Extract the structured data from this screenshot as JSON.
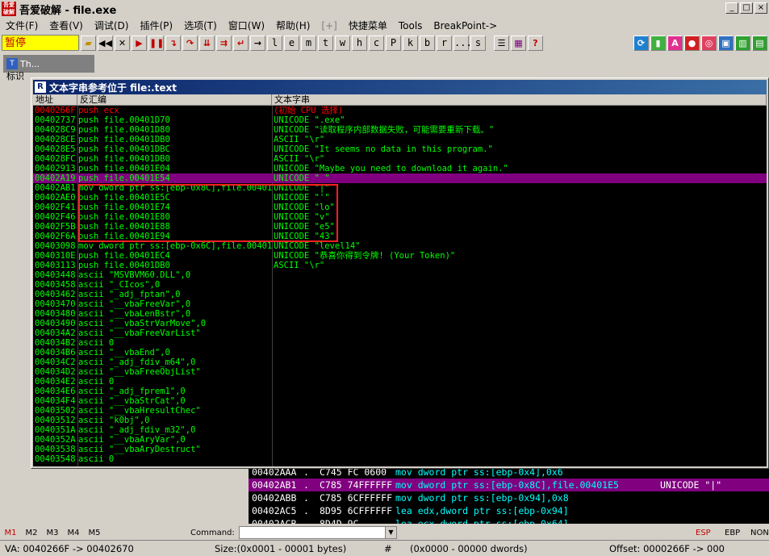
{
  "window": {
    "logo_text": "吾爱破解",
    "title": "吾爱破解 - file.exe",
    "min": "_",
    "max": "□",
    "close": "×"
  },
  "menu": [
    "文件(F)",
    "查看(V)",
    "调试(D)",
    "插件(P)",
    "选项(T)",
    "窗口(W)",
    "帮助(H)",
    "[+]",
    "快捷菜单",
    "Tools",
    "BreakPoint->"
  ],
  "toolbar": {
    "status": "暂停",
    "letters": [
      "l",
      "e",
      "m",
      "t",
      "w",
      "h",
      "c",
      "P",
      "k",
      "b",
      "r",
      "...",
      "s"
    ]
  },
  "mini_window": {
    "icon": "T",
    "title": "Th...",
    "label": "标识"
  },
  "dialog": {
    "icon": "R",
    "title": "文本字串参考位于 file:.text",
    "columns": [
      "地址",
      "反汇编",
      "文本字串"
    ],
    "rows": [
      {
        "addr": "0040266F",
        "dis": "push ecx",
        "str": "(初始 CPU 选择)",
        "style": "r"
      },
      {
        "addr": "00402737",
        "dis": "push file.00401D70",
        "str": "UNICODE \".exe\"",
        "style": "g"
      },
      {
        "addr": "004028C9",
        "dis": "push file.00401D80",
        "str": "UNICODE \"读取程序内部数据失败，可能需要重新下载。\"",
        "style": "g"
      },
      {
        "addr": "004028CE",
        "dis": "push file.00401DB0",
        "str": "ASCII \"\\r\"",
        "style": "g"
      },
      {
        "addr": "004028E5",
        "dis": "push file.00401DBC",
        "str": "UNICODE \"It seems no data in this program.\"",
        "style": "g"
      },
      {
        "addr": "004028FC",
        "dis": "push file.00401DB0",
        "str": "ASCII \"\\r\"",
        "style": "g"
      },
      {
        "addr": "00402913",
        "dis": "push file.00401E04",
        "str": "UNICODE \"Maybe you need to download it again.\"",
        "style": "g"
      },
      {
        "addr": "00402A19",
        "dis": "push file.00401E54",
        "str": "UNICODE \" \"",
        "style": "sel"
      },
      {
        "addr": "00402AB1",
        "dis": "mov dword ptr ss:[ebp-0x8C],file.00401E5",
        "str": "UNICODE \"|\"",
        "style": "g"
      },
      {
        "addr": "00402AE0",
        "dis": "push file.00401E5C",
        "str": "UNICODE \"'\"",
        "style": "g"
      },
      {
        "addr": "00402F41",
        "dis": "push file.00401E74",
        "str": "UNICODE \"lo\"",
        "style": "g"
      },
      {
        "addr": "00402F46",
        "dis": "push file.00401E80",
        "str": "UNICODE \"v\"",
        "style": "g"
      },
      {
        "addr": "00402F5B",
        "dis": "push file.00401E88",
        "str": "UNICODE \"e5\"",
        "style": "g"
      },
      {
        "addr": "00402F6A",
        "dis": "push file.00401E94",
        "str": "UNICODE \"43\"",
        "style": "g"
      },
      {
        "addr": "00403098",
        "dis": "mov dword ptr ss:[ebp-0x6C],file.00401EA",
        "str": "UNICODE \"level14\"",
        "style": "g"
      },
      {
        "addr": "0040310E",
        "dis": "push file.00401EC4",
        "str": "UNICODE \"恭喜你得到令牌! (Your Token)\"",
        "style": "g"
      },
      {
        "addr": "00403113",
        "dis": "push file.00401DB0",
        "str": "ASCII \"\\r\"",
        "style": "g"
      },
      {
        "addr": "00403448",
        "dis": "ascii \"MSVBVM60.DLL\",0",
        "str": "",
        "style": "g"
      },
      {
        "addr": "00403458",
        "dis": "ascii \"_CIcos\",0",
        "str": "",
        "style": "g"
      },
      {
        "addr": "00403462",
        "dis": "ascii \"_adj_fptan\",0",
        "str": "",
        "style": "g"
      },
      {
        "addr": "00403470",
        "dis": "ascii \"__vbaFreeVar\",0",
        "str": "",
        "style": "g"
      },
      {
        "addr": "00403480",
        "dis": "ascii \"__vbaLenBstr\",0",
        "str": "",
        "style": "g"
      },
      {
        "addr": "00403490",
        "dis": "ascii \"__vbaStrVarMove\",0",
        "str": "",
        "style": "g"
      },
      {
        "addr": "004034A2",
        "dis": "ascii \"__vbaFreeVarList\"",
        "str": "",
        "style": "g"
      },
      {
        "addr": "004034B2",
        "dis": "ascii 0",
        "str": "",
        "style": "g"
      },
      {
        "addr": "004034B6",
        "dis": "ascii \"__vbaEnd\",0",
        "str": "",
        "style": "g"
      },
      {
        "addr": "004034C2",
        "dis": "ascii \"_adj_fdiv_m64\",0",
        "str": "",
        "style": "g"
      },
      {
        "addr": "004034D2",
        "dis": "ascii \"__vbaFreeObjList\"",
        "str": "",
        "style": "g"
      },
      {
        "addr": "004034E2",
        "dis": "ascii 0",
        "str": "",
        "style": "g"
      },
      {
        "addr": "004034E6",
        "dis": "ascii \"_adj_fprem1\",0",
        "str": "",
        "style": "g"
      },
      {
        "addr": "004034F4",
        "dis": "ascii \"__vbaStrCat\",0",
        "str": "",
        "style": "g"
      },
      {
        "addr": "00403502",
        "dis": "ascii \"__vbaHresultChec\"",
        "str": "",
        "style": "g"
      },
      {
        "addr": "00403512",
        "dis": "ascii \"k0bj\",0",
        "str": "",
        "style": "g"
      },
      {
        "addr": "0040351A",
        "dis": "ascii \"_adj_fdiv_m32\",0",
        "str": "",
        "style": "g"
      },
      {
        "addr": "0040352A",
        "dis": "ascii \"__vbaAryVar\",0",
        "str": "",
        "style": "g"
      },
      {
        "addr": "00403538",
        "dis": "ascii \"__vbaAryDestruct\"",
        "str": "",
        "style": "g"
      },
      {
        "addr": "00403548",
        "dis": "ascii 0",
        "str": "",
        "style": "g"
      }
    ]
  },
  "cpu": [
    {
      "addr": "00402AAA",
      "mark": ".",
      "bytes": "C745 FC 0600",
      "dis": "mov dword ptr ss:[ebp-0x4],0x6",
      "str": "",
      "sel": false
    },
    {
      "addr": "00402AB1",
      "mark": ".",
      "bytes": "C785 74FFFFFF",
      "dis": "mov dword ptr ss:[ebp-0x8C],file.00401E5",
      "str": "UNICODE \"|\"",
      "sel": true
    },
    {
      "addr": "00402ABB",
      "mark": ".",
      "bytes": "C785 6CFFFFFF",
      "dis": "mov dword ptr ss:[ebp-0x94],0x8",
      "str": "",
      "sel": false
    },
    {
      "addr": "00402AC5",
      "mark": ".",
      "bytes": "8D95 6CFFFFFF",
      "dis": "lea edx,dword ptr ss:[ebp-0x94]",
      "str": "",
      "sel": false
    },
    {
      "addr": "00402ACB",
      "mark": ".",
      "bytes": "8D4D 9C",
      "dis": "lea ecx,dword ptr ss:[ebp-0x64]",
      "str": "",
      "sel": false
    }
  ],
  "cmdbar": {
    "tabs": [
      "M1",
      "M2",
      "M3",
      "M4",
      "M5"
    ],
    "label": "Command:",
    "regs": [
      "ESP",
      "EBP",
      "NONE"
    ]
  },
  "status": {
    "va": "VA: 0040266F -> 00402670",
    "size": "Size:(0x0001 - 00001 bytes)",
    "hash": "#",
    "dwords": "(0x0000 - 00000 dwords)",
    "offset": "Offset: 0000266F -> 000"
  }
}
